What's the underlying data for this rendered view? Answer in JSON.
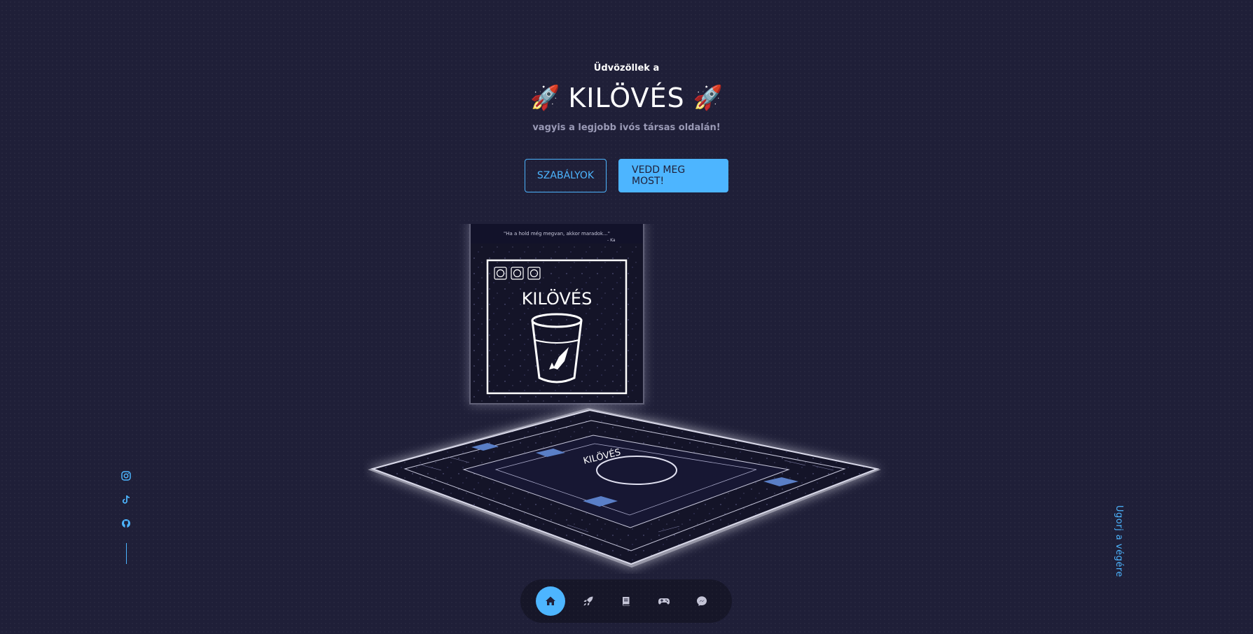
{
  "header": {
    "greeting": "Üdvözöllek a",
    "title": "KILÖVÉS",
    "title_emoji": "🚀",
    "subtitle": "vagyis a legjobb ivós társas oldalán!"
  },
  "cta": {
    "rules_label": "SZABÁLYOK",
    "buy_label": "VEDD MEG MOST!"
  },
  "hero": {
    "box_title": "KILÖVÉS",
    "box_quote": "\"Ha a hold még megvan, akkor maradok...\"",
    "box_quote_author": "- Ka",
    "board_title": "KILÖVÉS"
  },
  "socials": {
    "items": [
      {
        "icon": "instagram-icon"
      },
      {
        "icon": "tiktok-icon"
      },
      {
        "icon": "github-icon"
      }
    ]
  },
  "scroll_link": "Ugorj a végére",
  "nav": {
    "items": [
      {
        "icon": "home-icon",
        "active": true
      },
      {
        "icon": "rocket-icon",
        "active": false
      },
      {
        "icon": "book-icon",
        "active": false
      },
      {
        "icon": "gamepad-icon",
        "active": false
      },
      {
        "icon": "messenger-icon",
        "active": false
      }
    ]
  },
  "colors": {
    "background": "#1f1f38",
    "accent": "#4db5ff",
    "muted_text": "#9a9ab6"
  }
}
